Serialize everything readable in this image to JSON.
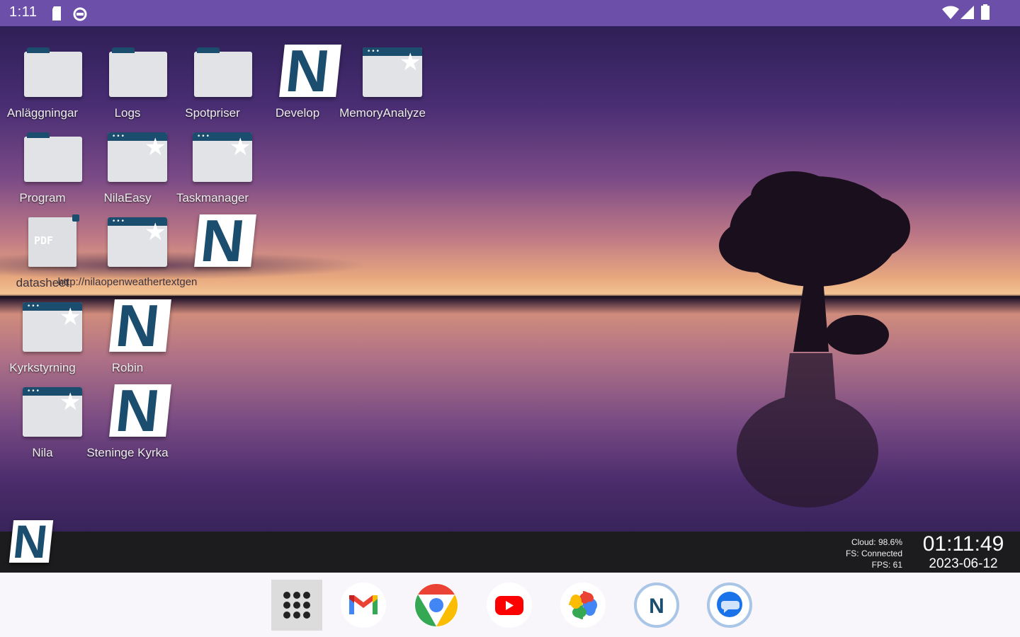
{
  "status_bar": {
    "time": "1:11",
    "icons": [
      "sd-card-icon",
      "sync-icon",
      "wifi-icon",
      "cell-signal-icon",
      "battery-icon"
    ]
  },
  "desktop": {
    "icons": [
      {
        "label": "Anläggningar",
        "type": "folder"
      },
      {
        "label": "Logs",
        "type": "folder"
      },
      {
        "label": "Spotpriser",
        "type": "folder"
      },
      {
        "label": "Develop",
        "type": "nila-app"
      },
      {
        "label": "MemoryAnalyze",
        "type": "web-app"
      },
      {
        "label": "Program",
        "type": "folder"
      },
      {
        "label": "NilaEasy",
        "type": "web-app"
      },
      {
        "label": "Taskmanager",
        "type": "web-app"
      },
      {
        "label": "datasheet",
        "type": "pdf"
      },
      {
        "label": "http://nilaopenweathertextgen",
        "type": "web-app"
      },
      {
        "label": "",
        "type": "nila-app"
      },
      {
        "label": "Kyrkstyrning",
        "type": "web-app"
      },
      {
        "label": "Robin",
        "type": "nila-app"
      },
      {
        "label": "Nila",
        "type": "web-app"
      },
      {
        "label": "Steninge Kyrka",
        "type": "nila-app"
      }
    ]
  },
  "taskbar": {
    "start_logo": "N",
    "sysinfo": {
      "cloud": "Cloud: 98.6%",
      "fs": "FS: Connected",
      "fps": "FPS: 61"
    },
    "clock": {
      "time": "01:11:49",
      "date": "2023-06-12"
    }
  },
  "dock": {
    "apps": [
      "App drawer",
      "Gmail",
      "Chrome",
      "YouTube",
      "Photos",
      "Nila",
      "Messages"
    ]
  },
  "colors": {
    "status_bar": "#6b4fa8",
    "brand": "#1b4d6e",
    "taskbar": "#1c1c1e",
    "dock": "#f8f6fb"
  }
}
